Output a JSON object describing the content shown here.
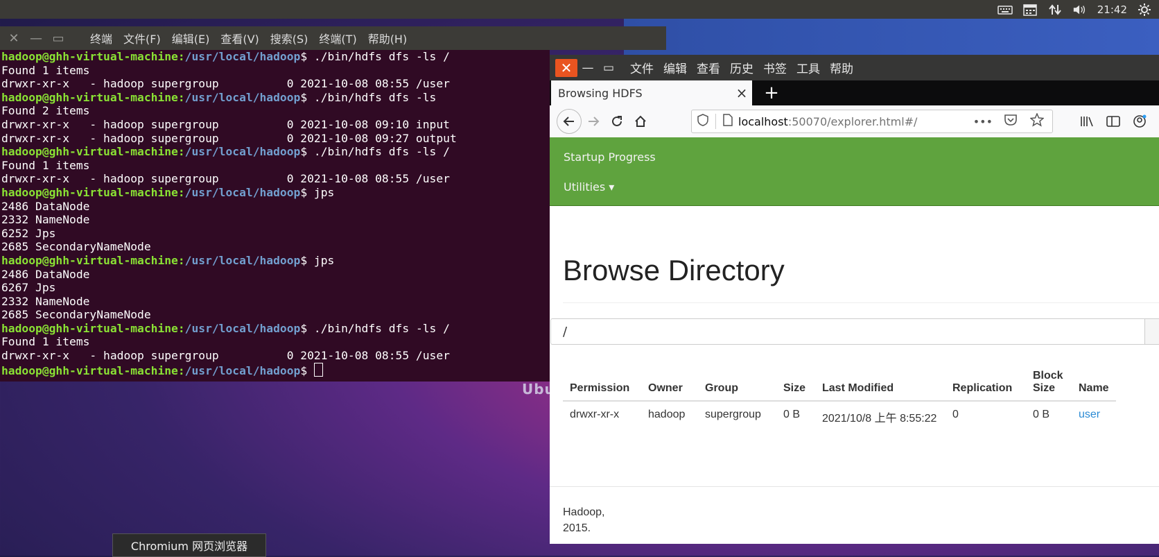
{
  "topbar": {
    "time": "21:42"
  },
  "terminal": {
    "title": "终端",
    "menu": [
      "文件(F)",
      "编辑(E)",
      "查看(V)",
      "搜索(S)",
      "终端(T)",
      "帮助(H)"
    ],
    "prompt_user": "hadoop@ghh-virtual-machine",
    "prompt_path": "/usr/local/hadoop",
    "lines": [
      {
        "t": "p",
        "cmd": "./bin/hdfs dfs -ls /"
      },
      {
        "t": "o",
        "text": "Found 1 items"
      },
      {
        "t": "o",
        "text": "drwxr-xr-x   - hadoop supergroup          0 2021-10-08 08:55 /user"
      },
      {
        "t": "p",
        "cmd": "./bin/hdfs dfs -ls"
      },
      {
        "t": "o",
        "text": "Found 2 items"
      },
      {
        "t": "o",
        "text": "drwxr-xr-x   - hadoop supergroup          0 2021-10-08 09:10 input"
      },
      {
        "t": "o",
        "text": "drwxr-xr-x   - hadoop supergroup          0 2021-10-08 09:27 output"
      },
      {
        "t": "p",
        "cmd": "./bin/hdfs dfs -ls /"
      },
      {
        "t": "o",
        "text": "Found 1 items"
      },
      {
        "t": "o",
        "text": "drwxr-xr-x   - hadoop supergroup          0 2021-10-08 08:55 /user"
      },
      {
        "t": "p",
        "cmd": "jps"
      },
      {
        "t": "o",
        "text": "2486 DataNode"
      },
      {
        "t": "o",
        "text": "2332 NameNode"
      },
      {
        "t": "o",
        "text": "6252 Jps"
      },
      {
        "t": "o",
        "text": "2685 SecondaryNameNode"
      },
      {
        "t": "p",
        "cmd": "jps"
      },
      {
        "t": "o",
        "text": "2486 DataNode"
      },
      {
        "t": "o",
        "text": "6267 Jps"
      },
      {
        "t": "o",
        "text": "2332 NameNode"
      },
      {
        "t": "o",
        "text": "2685 SecondaryNameNode"
      },
      {
        "t": "p",
        "cmd": "./bin/hdfs dfs -ls /"
      },
      {
        "t": "o",
        "text": "Found 1 items"
      },
      {
        "t": "o",
        "text": "drwxr-xr-x   - hadoop supergroup          0 2021-10-08 08:55 /user"
      },
      {
        "t": "c",
        "cmd": ""
      }
    ]
  },
  "desktop": {
    "ubuntu_text": "Ubu",
    "tooltip": "Chromium 网页浏览器"
  },
  "browser": {
    "menu": [
      "文件",
      "编辑",
      "查看",
      "历史",
      "书签",
      "工具",
      "帮助"
    ],
    "tab_title": "Browsing HDFS",
    "url_host": "localhost",
    "url_rest": ":50070/explorer.html#/",
    "nav_items": [
      "Startup Progress",
      "Utilities ▾"
    ],
    "page_title": "Browse Directory",
    "path_value": "/",
    "table": {
      "headers": [
        "Permission",
        "Owner",
        "Group",
        "Size",
        "Last Modified",
        "Replication",
        "Block Size",
        "Name"
      ],
      "rows": [
        [
          "drwxr-xr-x",
          "hadoop",
          "supergroup",
          "0 B",
          "2021/10/8 上午 8:55:22",
          "0",
          "0 B",
          "user"
        ]
      ]
    },
    "footer_line1": "Hadoop,",
    "footer_line2": "2015."
  }
}
